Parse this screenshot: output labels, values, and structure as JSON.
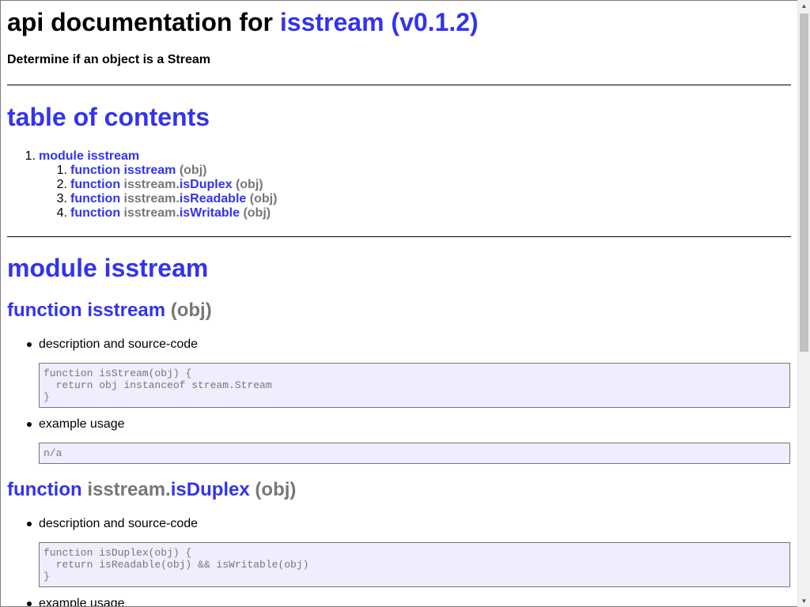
{
  "header": {
    "title_prefix": "api documentation for",
    "package_link": "isstream (v0.1.2)",
    "description": "Determine if an object is a Stream"
  },
  "toc": {
    "title": "table of contents",
    "module_num": "1.",
    "module_label": "module isstream",
    "items": [
      {
        "num": "1.",
        "kw": "function",
        "prefix": "",
        "name": "isstream",
        "args": "(obj)"
      },
      {
        "num": "2.",
        "kw": "function",
        "prefix": "isstream.",
        "name": "isDuplex",
        "args": "(obj)"
      },
      {
        "num": "3.",
        "kw": "function",
        "prefix": "isstream.",
        "name": "isReadable",
        "args": "(obj)"
      },
      {
        "num": "4.",
        "kw": "function",
        "prefix": "isstream.",
        "name": "isWritable",
        "args": "(obj)"
      }
    ]
  },
  "module": {
    "title": "module isstream",
    "functions": [
      {
        "kw": "function",
        "prefix": "",
        "name": "isstream",
        "args": "(obj)",
        "desc_label": "description and source-code",
        "source": "function isStream(obj) {\n  return obj instanceof stream.Stream\n}",
        "example_label": "example usage",
        "example": "n/a"
      },
      {
        "kw": "function",
        "prefix": "isstream.",
        "name": "isDuplex",
        "args": "(obj)",
        "desc_label": "description and source-code",
        "source": "function isDuplex(obj) {\n  return isReadable(obj) && isWritable(obj)\n}",
        "example_label": "example usage"
      }
    ]
  },
  "colors": {
    "link": "#3333ee",
    "muted": "#777777",
    "code_bg": "#eeeeff"
  }
}
